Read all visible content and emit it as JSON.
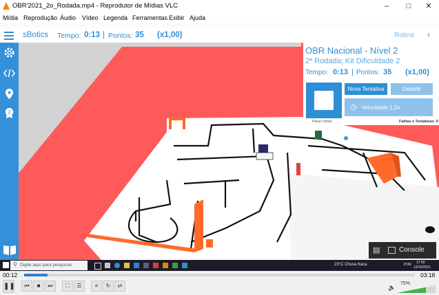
{
  "window": {
    "title": "OBR'2021_2o_Rodada.mp4 - Reprodutor de Mídias VLC"
  },
  "menu": [
    "Mídia",
    "Reprodução",
    "Áudio",
    "Vídeo",
    "Legenda",
    "Ferramentas",
    "Exibir",
    "Ajuda"
  ],
  "sbotics": {
    "brand": "sBotics",
    "tempo_label": "Tempo:",
    "tempo_value": "0:13",
    "pontos_label": "Pontos:",
    "pontos_value": "35",
    "multiplier": "(x1,00)",
    "rotina": "Rotina"
  },
  "panel": {
    "title": "OBR Nacional - Nível 2",
    "subtitle": "2ª Rodada; Kit Dificuldade 2",
    "tempo_label": "Tempo:",
    "tempo_value": "0:13",
    "pontos_label": "Pontos:",
    "pontos_value": "35",
    "multiplier": "(x1,00)",
    "nova_tentativa": "Nova Tentativa",
    "desistir": "Desistir",
    "velocidade": "Velocidade 1,0x",
    "parar_rotina": "Parar rotina",
    "falhas": "Falhas e Tentativas: 0"
  },
  "console_label": "Console",
  "taskbar": {
    "search_placeholder": "Digite aqui para pesquisar",
    "weather": "23°C  Chuva fraca",
    "clock_time": "17:00",
    "clock_date": "12/10/2021",
    "lang": "POR"
  },
  "player": {
    "elapsed": "00:12",
    "total": "03:18",
    "progress": 0.06,
    "volume": "75%",
    "volume_level": 0.75
  },
  "colors": {
    "accent": "#2d8fd5",
    "field_red": "#ff5a5a",
    "obstacle_orange": "#ff6a2a"
  }
}
